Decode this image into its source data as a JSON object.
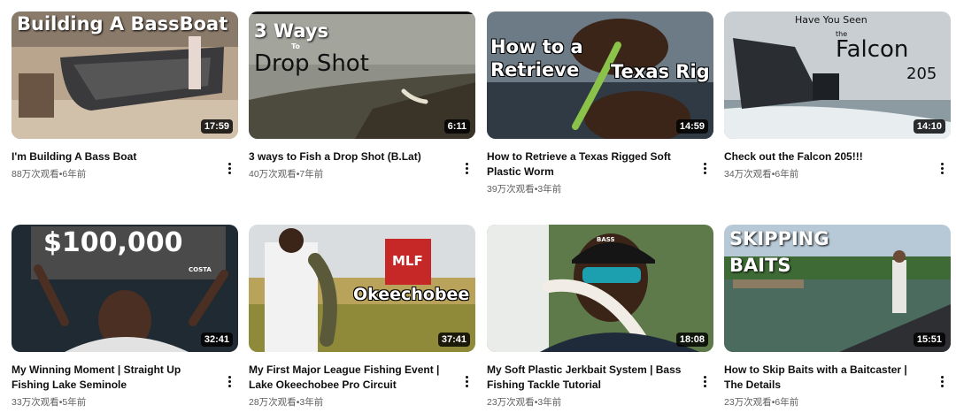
{
  "videos": [
    {
      "title": "I'm Building A Bass Boat",
      "views": "88万次观看",
      "age": "6年前",
      "duration": "17:59",
      "overlay": [
        "Building A BassBoat"
      ]
    },
    {
      "title": "3 ways to Fish a Drop Shot (B.Lat)",
      "views": "40万次观看",
      "age": "7年前",
      "duration": "6:11",
      "overlay": [
        "3 Ways",
        "To",
        "Drop Shot"
      ]
    },
    {
      "title": "How to Retrieve a Texas Rigged Soft Plastic Worm",
      "views": "39万次观看",
      "age": "3年前",
      "duration": "14:59",
      "overlay": [
        "How to a",
        "Retrieve",
        "Texas Rig"
      ]
    },
    {
      "title": "Check out the Falcon 205!!!",
      "views": "34万次观看",
      "age": "6年前",
      "duration": "14:10",
      "overlay": [
        "Have You Seen",
        "the",
        "Falcon",
        "205"
      ]
    },
    {
      "title": "My Winning Moment | Straight Up Fishing Lake Seminole",
      "views": "33万次观看",
      "age": "5年前",
      "duration": "32:41",
      "overlay": [
        "$100,000",
        "COSTA"
      ]
    },
    {
      "title": "My First Major League Fishing Event | Lake Okeechobee Pro Circuit",
      "views": "28万次观看",
      "age": "3年前",
      "duration": "37:41",
      "overlay": [
        "MLF",
        "Okeechobee"
      ]
    },
    {
      "title": "My Soft Plastic Jerkbait System | Bass Fishing Tackle Tutorial",
      "views": "23万次观看",
      "age": "3年前",
      "duration": "18:08",
      "overlay": [
        "BASS"
      ]
    },
    {
      "title": "How to Skip Baits with a Baitcaster | The Details",
      "views": "23万次观看",
      "age": "6年前",
      "duration": "15:51",
      "overlay": [
        "SKIPPING",
        "BAITS"
      ]
    }
  ],
  "separator": "•",
  "icons": {
    "more": "more-vert-icon"
  }
}
